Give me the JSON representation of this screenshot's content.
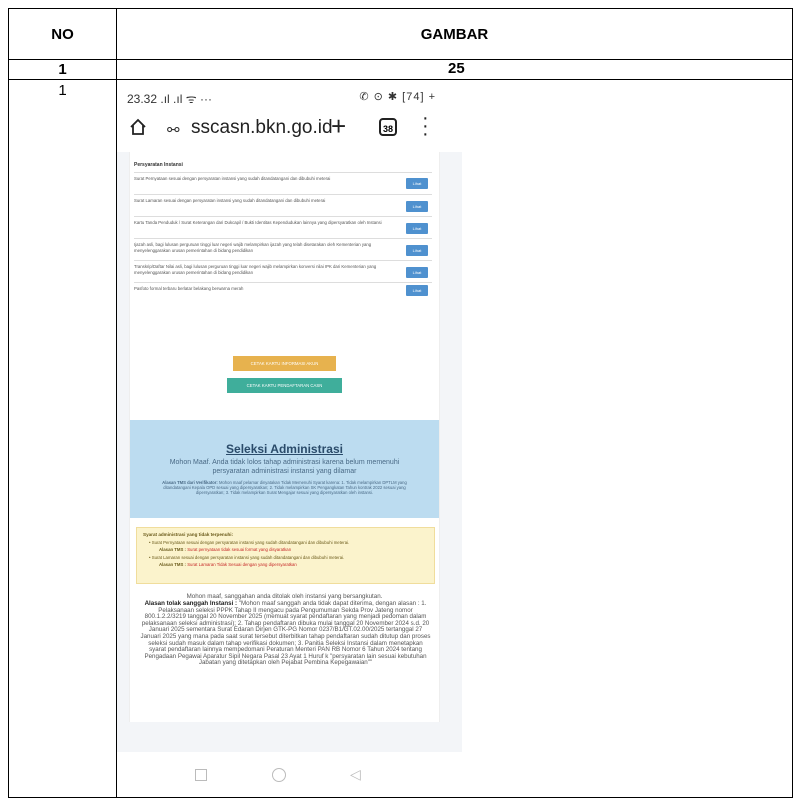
{
  "table": {
    "header": {
      "no": "NO",
      "gambar": "GAMBAR"
    },
    "row2": {
      "no": "1",
      "gambar": "25"
    },
    "row3": {
      "no": "1"
    }
  },
  "phone": {
    "status_time": "23.32 .ıl .ıl ᯤ ···",
    "status_right": "✆ ⊙ ✱ [74] +",
    "url": "sscasn.bkn.go.id",
    "tab_count": "38",
    "requirements": {
      "title": "Persyaratan Instansi",
      "button_label": "Lihat",
      "items": [
        "Surat Pernyataan sesuai dengan persyaratan instansi yang sudah ditandatangani dan dibubuhi meterai",
        "Surat Lamaran sesuai dengan persyaratan instansi yang sudah ditandatangani dan dibubuhi meterai",
        "Kartu Tanda Penduduk / Surat Keterangan dari Dukcapil / Bukti Identitas Kependudukan lainnya yang dipersyaratkan oleh Instansi",
        "Ijazah asli, bagi lulusan perguruan tinggi luar negeri wajib melampirkan ijazah yang telah disetarakan oleh Kementerian yang menyelenggarakan urusan pemerintahan di bidang pendidikan",
        "Transkrip/Daftar Nilai asli, bagi lulusan perguruan tinggi luar negeri wajib melampirkan konversi nilai IPK dari Kementerian yang menyelenggarakan urusan pemerintahan di bidang pendidikan",
        "Pasfoto formal terbaru berlatar belakang berwarna merah"
      ]
    },
    "btn_cetak_akun": "CETAK KARTU INFORMASI AKUN",
    "btn_cetak_casn": "CETAK KARTU PENDAFTARAN CASN",
    "seleksi": {
      "title": "Seleksi Administrasi",
      "subtitle": "Mohon Maaf. Anda tidak lolos tahap administrasi karena belum memenuhi persyaratan administrasi instansi yang dilamar",
      "note_label": "Alasan TMS dari Verifikator:",
      "note_text": "Mohon maaf pelamar dinyatakan Tidak Memenuhi Syarat karena: 1. Tidak melampirkan DPTLM yang ditandatangani Kepala OPD sesuai yang dipersyaratkan; 2. Tidak melampirkan SK Pengangkatan Tahun kontrak 2022 sesuai yang dipersyaratkan; 3. Tidak melampirkan Surat Mengajar sesuai yang dipersyaratkan oleh instansi."
    },
    "syarat": {
      "title": "Syarat administrasi yang tidak terpenuhi:",
      "item1": "• Surat Pernyataan sesuai dengan persyaratan instansi yang sudah ditandatangani dan dibubuhi meterai.",
      "item1_label": "Alasan TMS :",
      "item1_reason": "Surat pernyataan tidak sesuai format yang disyaratkan",
      "item2": "• Surat Lamaran sesuai dengan persyaratan instansi yang sudah ditandatangani dan dibubuhi meterai.",
      "item2_label": "Alasan TMS :",
      "item2_reason": "Surat Lamaran Tidak Sesuai dengan yang dipersyaratkan"
    },
    "sanggah": {
      "mohon": "Mohon maaf, sanggahan anda ditolak oleh instansi yang bersangkutan.",
      "label": "Alasan tolak sanggah Instansi :",
      "text": "\"Mohon maaf sanggah anda tidak dapat diterima, dengan alasan : 1. Pelaksanaan seleksi PPPK Tahap II mengacu pada Pengumuman Sekda Prov Jateng nomor 800.1.2.2/3219 tanggal 20 November 2025 (memuat syarat pendaftaran yang menjadi pedoman dalam pelaksanaan seleksi administrasi); 2. Tahap pendaftaran dibuka mulai tanggal 20 November 2024 s.d. 20 Januari 2025 sementara Surat Edaran Dirjen GTK-PG Nomor 0237/B1/GT.02.00/2025 tertanggal 27 Januari 2025 yang mana pada saat surat tersebut diterbitkan tahap pendaftaran sudah ditutup dan proses seleksi sudah masuk dalam tahap verifikasi dokumen; 3. Panitia Seleksi Instansi dalam menetapkan syarat pendaftaran lainnya mempedomani Peraturan Menteri PAN RB Nomor 6 Tahun 2024 tentang Pengadaan Pegawai Aparatur Sipil Negara Pasal 23 Ayat 1 Huruf k \"persyaratan lain sesuai kebutuhan Jabatan yang ditetapkan oleh Pejabat Pembina Kepegawaian\"\""
    }
  }
}
